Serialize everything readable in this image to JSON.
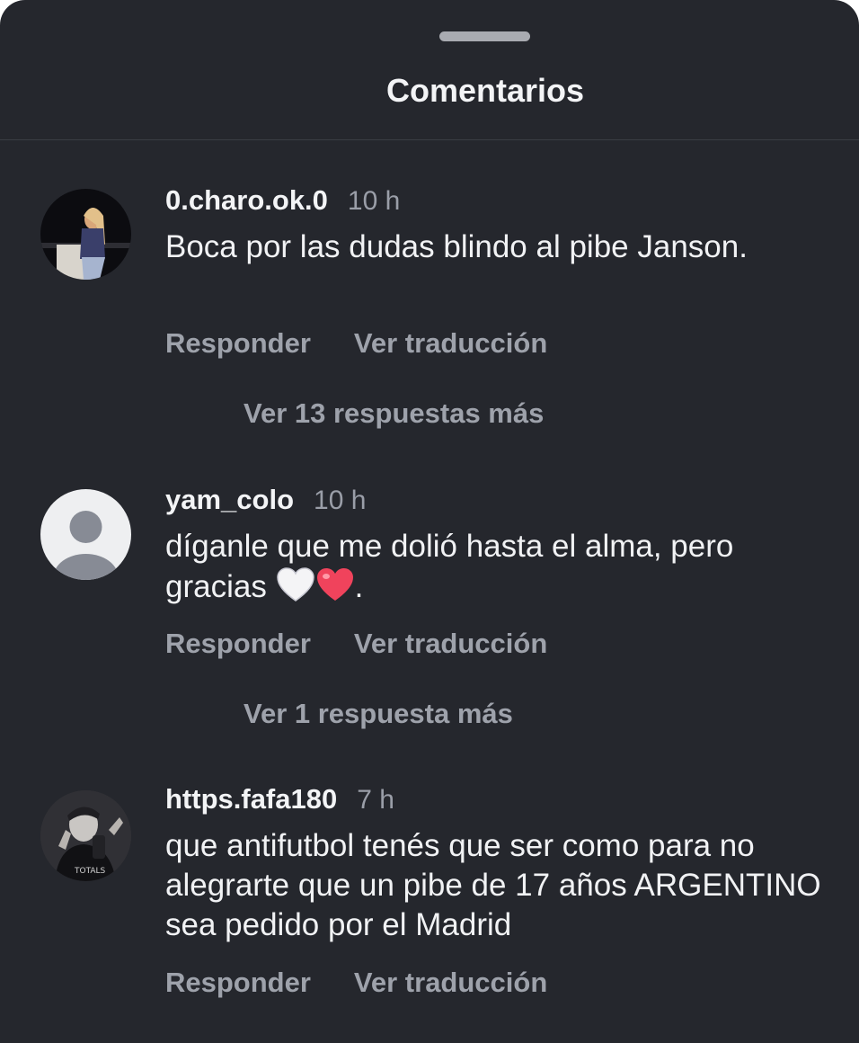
{
  "sheet": {
    "title": "Comentarios"
  },
  "comments": [
    {
      "username": "0.charo.ok.0",
      "time": "10 h",
      "text": "Boca por las dudas blindo al pibe Janson.",
      "reply_label": "Responder",
      "translate_label": "Ver traducción",
      "more_replies": "Ver 13 respuestas más",
      "avatar_icon": "profile-photo"
    },
    {
      "username": "yam_colo",
      "time": "10 h",
      "text_before": "díganle que me dolió hasta el alma, pero gracias ",
      "text_emojis": [
        "white-heart-icon",
        "red-heart-icon"
      ],
      "text_after": ".",
      "reply_label": "Responder",
      "translate_label": "Ver traducción",
      "more_replies": "Ver 1 respuesta más",
      "avatar_icon": "default-avatar-icon"
    },
    {
      "username": "https.fafa180",
      "time": "7 h",
      "text": "que antifutbol tenés que ser como para no alegrarte que un pibe de 17 años ARGENTINO sea pedido por el Madrid",
      "reply_label": "Responder",
      "translate_label": "Ver traducción",
      "avatar_icon": "profile-photo"
    }
  ],
  "colors": {
    "background": "#25272d",
    "primary_text": "#f3f4f6",
    "secondary_text": "#9ea2ab",
    "handle": "#a9abb1",
    "red_heart": "#f0435c",
    "white_heart": "#f4f4f6"
  }
}
